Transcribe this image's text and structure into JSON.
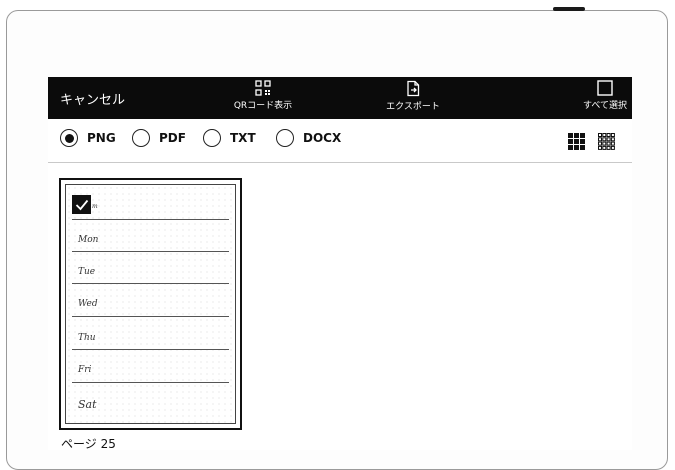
{
  "toolbar": {
    "cancel_label": "キャンセル",
    "qr_label": "QRコード表示",
    "export_label": "エクスポート",
    "select_all_label": "すべて選択"
  },
  "formats": [
    {
      "label": "PNG",
      "selected": true
    },
    {
      "label": "PDF",
      "selected": false
    },
    {
      "label": "TXT",
      "selected": false
    },
    {
      "label": "DOCX",
      "selected": false
    }
  ],
  "thumbnail": {
    "selected": true,
    "days": [
      "Mon",
      "Tue",
      "Wed",
      "Thu",
      "Fri",
      "Sat"
    ],
    "page_label": "ページ 25"
  },
  "colors": {
    "toolbar_bg": "#0b0b0b",
    "accent": "#111111"
  }
}
